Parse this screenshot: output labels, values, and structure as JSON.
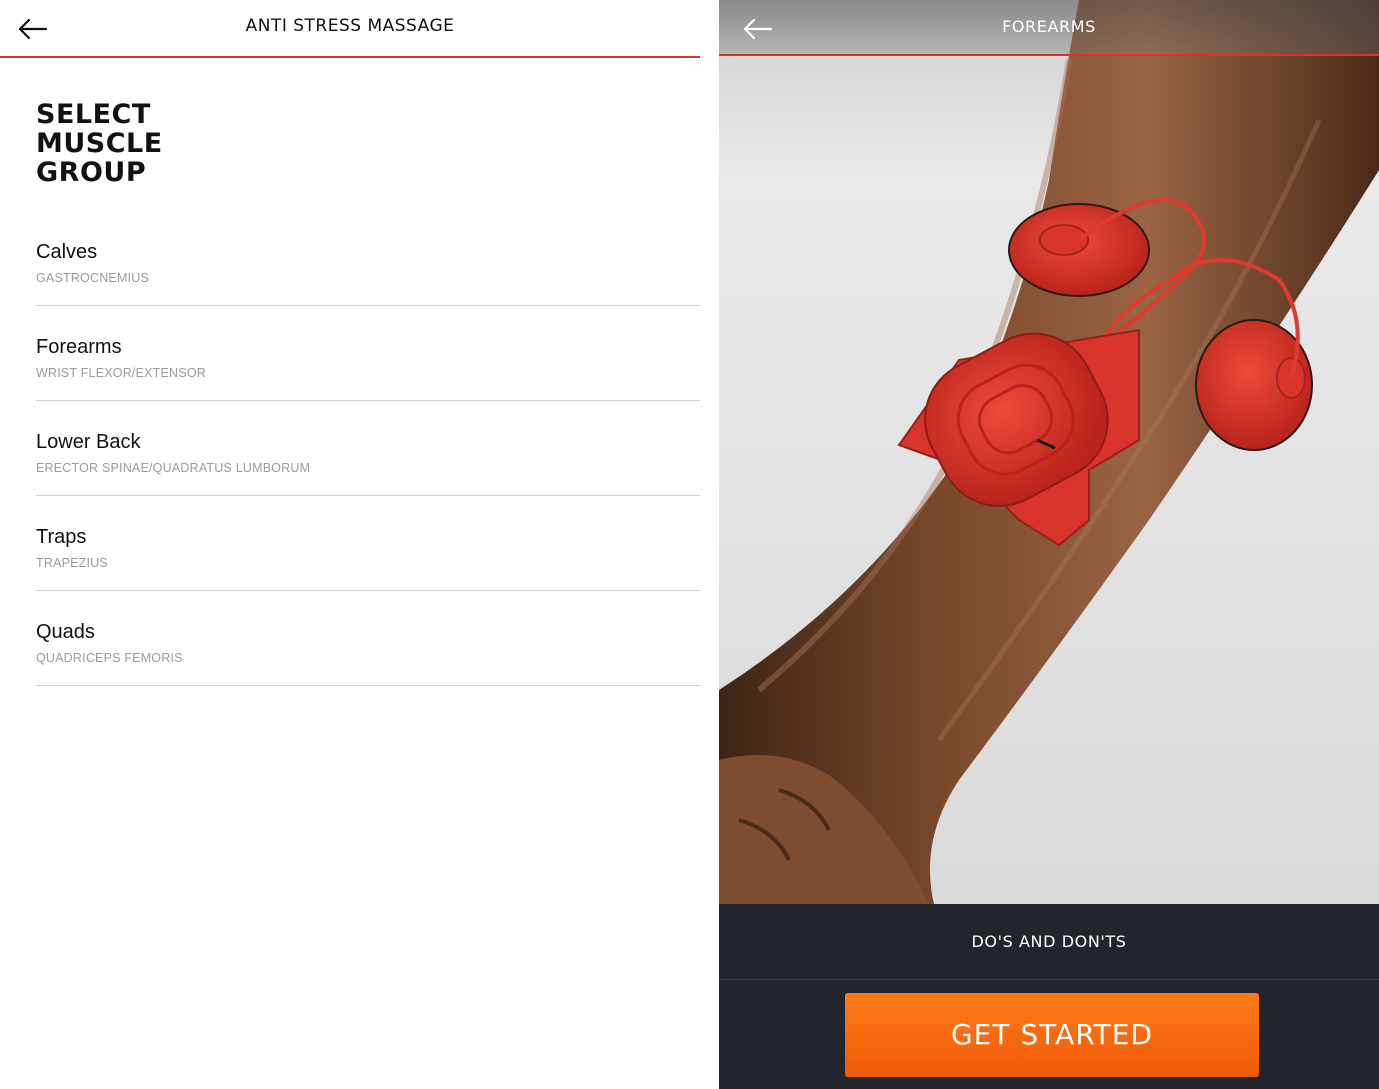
{
  "left_screen": {
    "title": "ANTI STRESS MASSAGE",
    "heading": "SELECT\nMUSCLE\nGROUP",
    "muscle_groups": [
      {
        "name": "Calves",
        "muscle": "GASTROCNEMIUS"
      },
      {
        "name": "Forearms",
        "muscle": "WRIST FLEXOR/EXTENSOR"
      },
      {
        "name": "Lower Back",
        "muscle": "ERECTOR SPINAE/QUADRATUS LUMBORUM"
      },
      {
        "name": "Traps",
        "muscle": "TRAPEZIUS"
      },
      {
        "name": "Quads",
        "muscle": "QUADRICEPS FEMORIS"
      }
    ]
  },
  "right_screen": {
    "title": "FOREARMS",
    "dos_and_donts_label": "DO'S AND DON'TS",
    "cta_label": "GET STARTED"
  },
  "icons": {
    "back": "back-arrow-icon"
  },
  "colors": {
    "accent_red": "#d9342b",
    "cta_orange": "#ff6a0e",
    "bottom_panel": "#23252c",
    "subtext_gray": "#9b9b9b"
  }
}
